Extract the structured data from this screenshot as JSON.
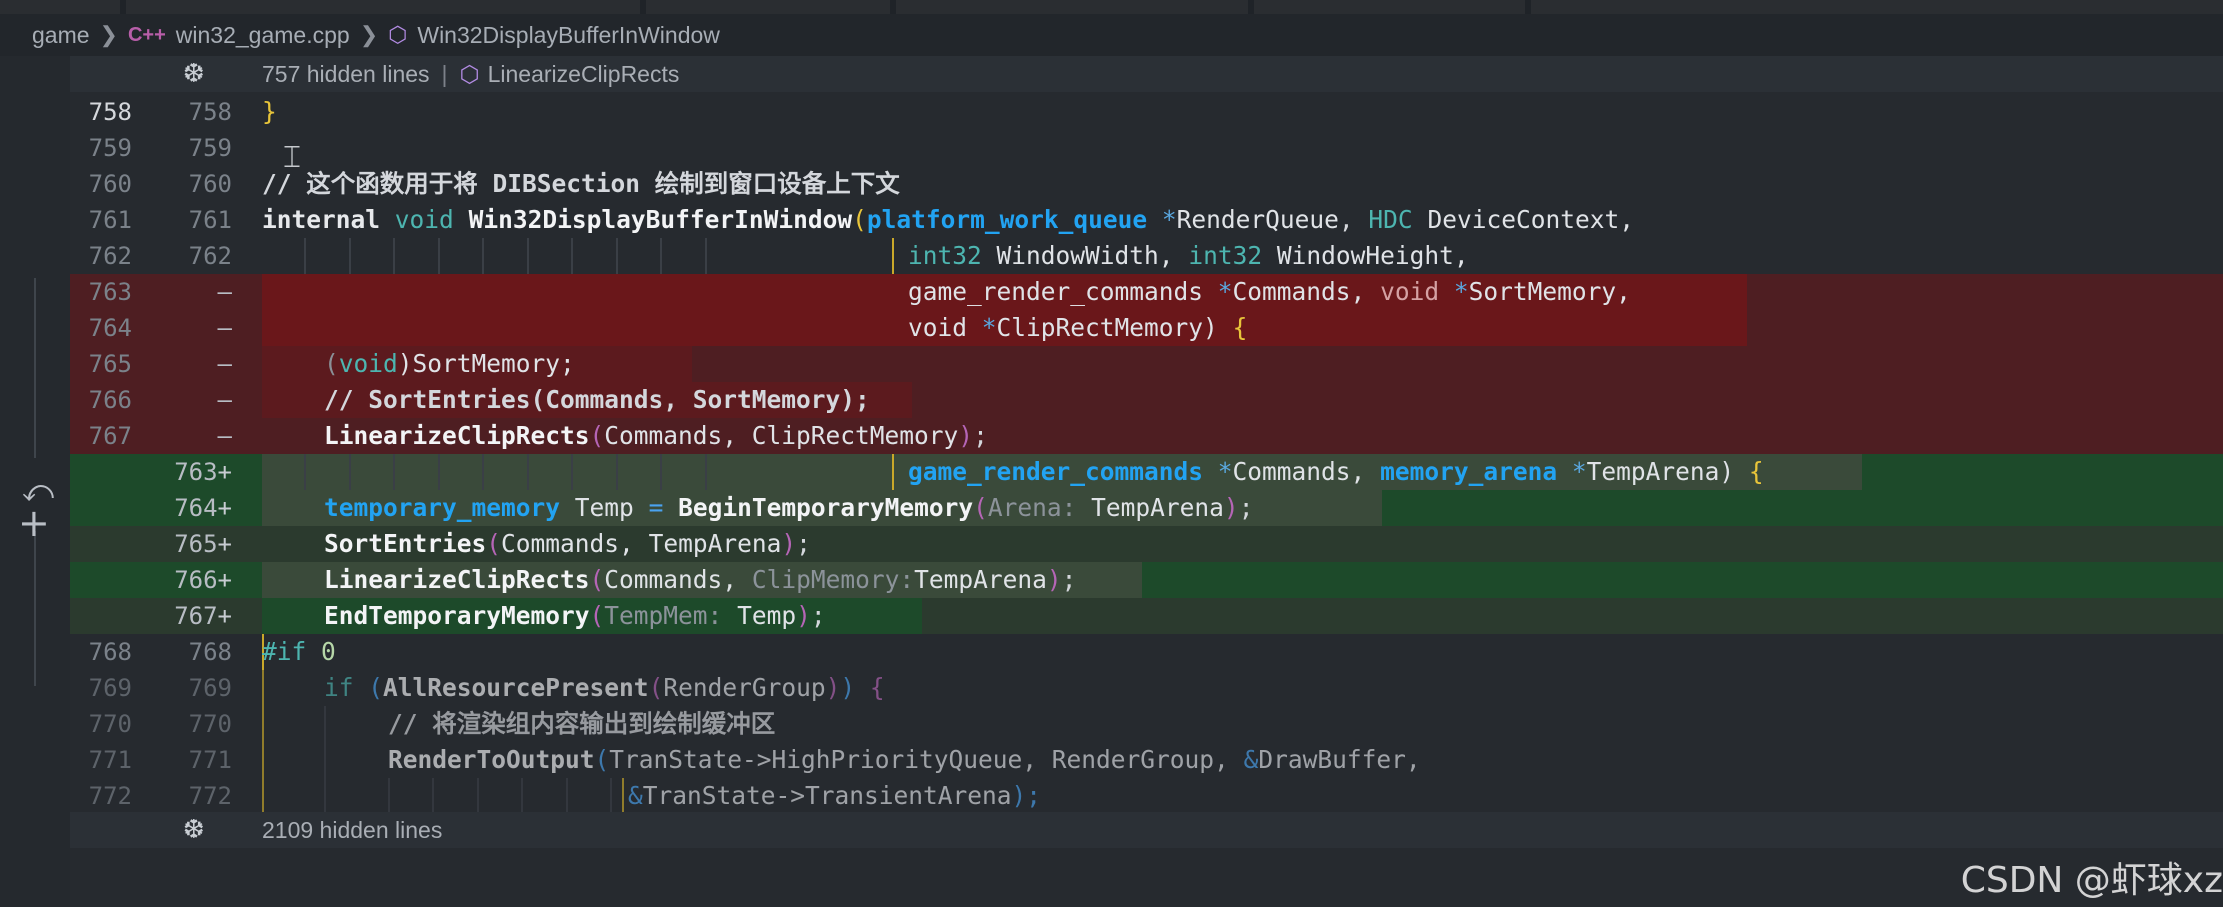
{
  "breadcrumb": {
    "folder": "game",
    "file_icon": "C++",
    "file": "win32_game.cpp",
    "symbol": "Win32DisplayBufferInWindow"
  },
  "folds": {
    "top_text": "757 hidden lines",
    "top_symbol": "LinearizeClipRects",
    "bottom_text": "2109 hidden lines"
  },
  "lines": [
    {
      "old": "758",
      "new": "758"
    },
    {
      "old": "759",
      "new": "759"
    },
    {
      "old": "760",
      "new": "760"
    },
    {
      "old": "761",
      "new": "761"
    },
    {
      "old": "762",
      "new": "762"
    },
    {
      "old": "763",
      "new": "—"
    },
    {
      "old": "764",
      "new": "—"
    },
    {
      "old": "765",
      "new": "—"
    },
    {
      "old": "766",
      "new": "—"
    },
    {
      "old": "767",
      "new": "—"
    },
    {
      "old": "",
      "new": "763+"
    },
    {
      "old": "",
      "new": "764+"
    },
    {
      "old": "",
      "new": "765+"
    },
    {
      "old": "",
      "new": "766+"
    },
    {
      "old": "",
      "new": "767+"
    },
    {
      "old": "768",
      "new": "768"
    },
    {
      "old": "769",
      "new": "769"
    },
    {
      "old": "770",
      "new": "770"
    },
    {
      "old": "771",
      "new": "771"
    },
    {
      "old": "772",
      "new": "772"
    }
  ],
  "code": {
    "l758": "}",
    "l760": "// 这个函数用于将 DIBSection 绘制到窗口设备上下文",
    "l761_kw": "internal",
    "l761_void": "void",
    "l761_fn": "Win32DisplayBufferInWindow",
    "l761_t1": "platform_work_queue",
    "l761_p1": "RenderQueue",
    "l761_t2": "HDC",
    "l761_p2": "DeviceContext,",
    "l762_t1": "int32",
    "l762_p1": "WindowWidth,",
    "l762_t2": "int32",
    "l762_p2": "WindowHeight,",
    "l763_t": "game_render_commands",
    "l763_p": "Commands,",
    "l763_v": "void",
    "l763_p2": "SortMemory,",
    "l764_v": "void",
    "l764_p": "ClipRectMemory)",
    "l765_a": "(",
    "l765_v": "void",
    "l765_b": ")SortMemory;",
    "l766": "// SortEntries(Commands, SortMemory);",
    "l767_fn": "LinearizeClipRects",
    "l767_args": "Commands, ClipRectMemory",
    "n763_t1": "game_render_commands",
    "n763_p1": "Commands,",
    "n763_t2": "memory_arena",
    "n763_p2": "TempArena)",
    "n764_t": "temporary_memory",
    "n764_p": "Temp",
    "n764_fn": "BeginTemporaryMemory",
    "n764_hint": "Arena:",
    "n764_arg": "TempArena",
    "n765_fn": "SortEntries",
    "n765_a1": "Commands,",
    "n765_a2": "TempArena",
    "n766_fn": "LinearizeClipRects",
    "n766_a1": "Commands,",
    "n766_hint": "ClipMemory:",
    "n766_a2": "TempArena",
    "n767_fn": "EndTemporaryMemory",
    "n767_hint": "TempMem:",
    "n767_arg": "Temp",
    "l768_pp": "#if",
    "l768_n": "0",
    "l769_kw": "if",
    "l769_fn": "AllResourcePresent",
    "l769_arg": "RenderGroup",
    "l770": "// 将渲染组内容输出到绘制缓冲区",
    "l771_fn": "RenderToOutput",
    "l771_args": "TranState->HighPriorityQueue, RenderGroup,",
    "l771_amp": "&",
    "l771_last": "DrawBuffer,",
    "l772_amp": "&",
    "l772_rest": "TranState->TransientArena",
    "l772_end": ");"
  },
  "watermark": "CSDN @虾球xz"
}
